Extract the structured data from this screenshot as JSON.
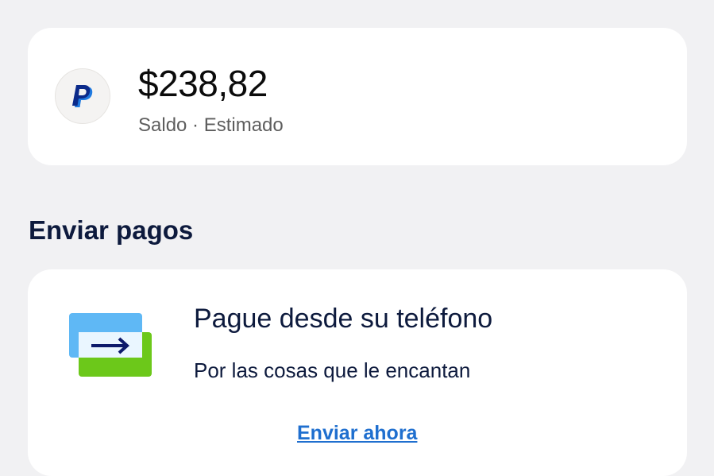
{
  "balance_card": {
    "logo_icon": "paypal-logo-icon",
    "amount": "$238,82",
    "subtitle": "Saldo · Estimado"
  },
  "send_section": {
    "title": "Enviar pagos",
    "card": {
      "illustration_icon": "send-payment-card-icon",
      "title": "Pague desde su teléfono",
      "subtitle": "Por las cosas que le encantan",
      "link_label": "Enviar ahora"
    }
  },
  "colors": {
    "background": "#f1f1f3",
    "card": "#ffffff",
    "heading": "#0d1a3d",
    "link": "#1f6fcf",
    "paypal_dark_blue": "#0b2a8a",
    "paypal_light_blue": "#1f7ae0",
    "illustration_light_blue": "#5fb8f5",
    "illustration_green": "#6cc81a"
  }
}
